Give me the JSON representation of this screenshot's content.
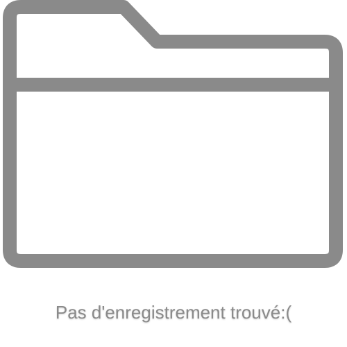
{
  "empty_state": {
    "icon": "folder-icon",
    "message": "Pas d'enregistrement trouvé:("
  },
  "colors": {
    "icon_stroke": "#8a8a8a",
    "text": "#8a8a8a",
    "background": "#ffffff"
  }
}
